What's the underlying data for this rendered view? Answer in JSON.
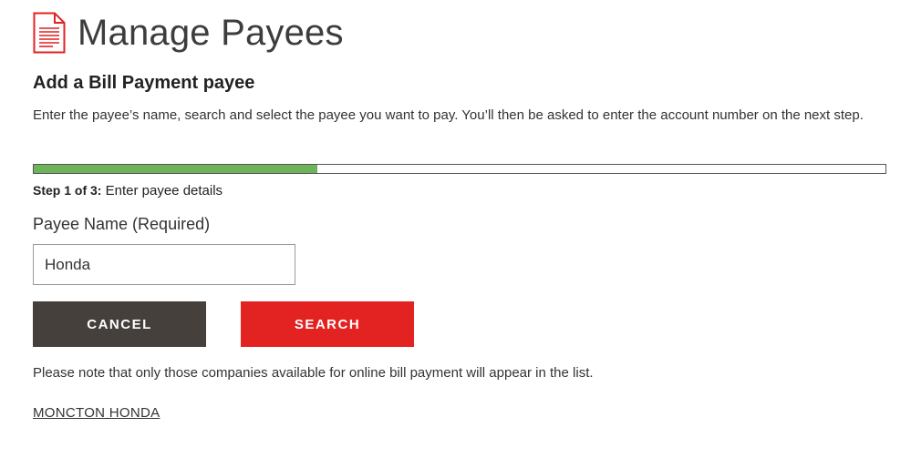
{
  "header": {
    "icon": "document-icon",
    "title": "Manage Payees"
  },
  "form": {
    "section_title": "Add a Bill Payment payee",
    "intro": "Enter the payee’s name, search and select the payee you want to pay. You’ll then be asked to enter the account number on the next step.",
    "progress": {
      "fraction": 0.333,
      "fill_color": "#6db35a",
      "step_label": "Step 1 of 3:",
      "step_text": " Enter payee details"
    },
    "payee_name": {
      "label": "Payee Name (Required)",
      "value": "Honda"
    },
    "buttons": {
      "cancel_label": "CANCEL",
      "cancel_color": "#46403d",
      "search_label": "SEARCH",
      "search_color": "#e32222"
    },
    "note": "Please note that only those companies available for online bill payment will appear in the list.",
    "results": [
      {
        "label": "MONCTON HONDA"
      }
    ]
  }
}
